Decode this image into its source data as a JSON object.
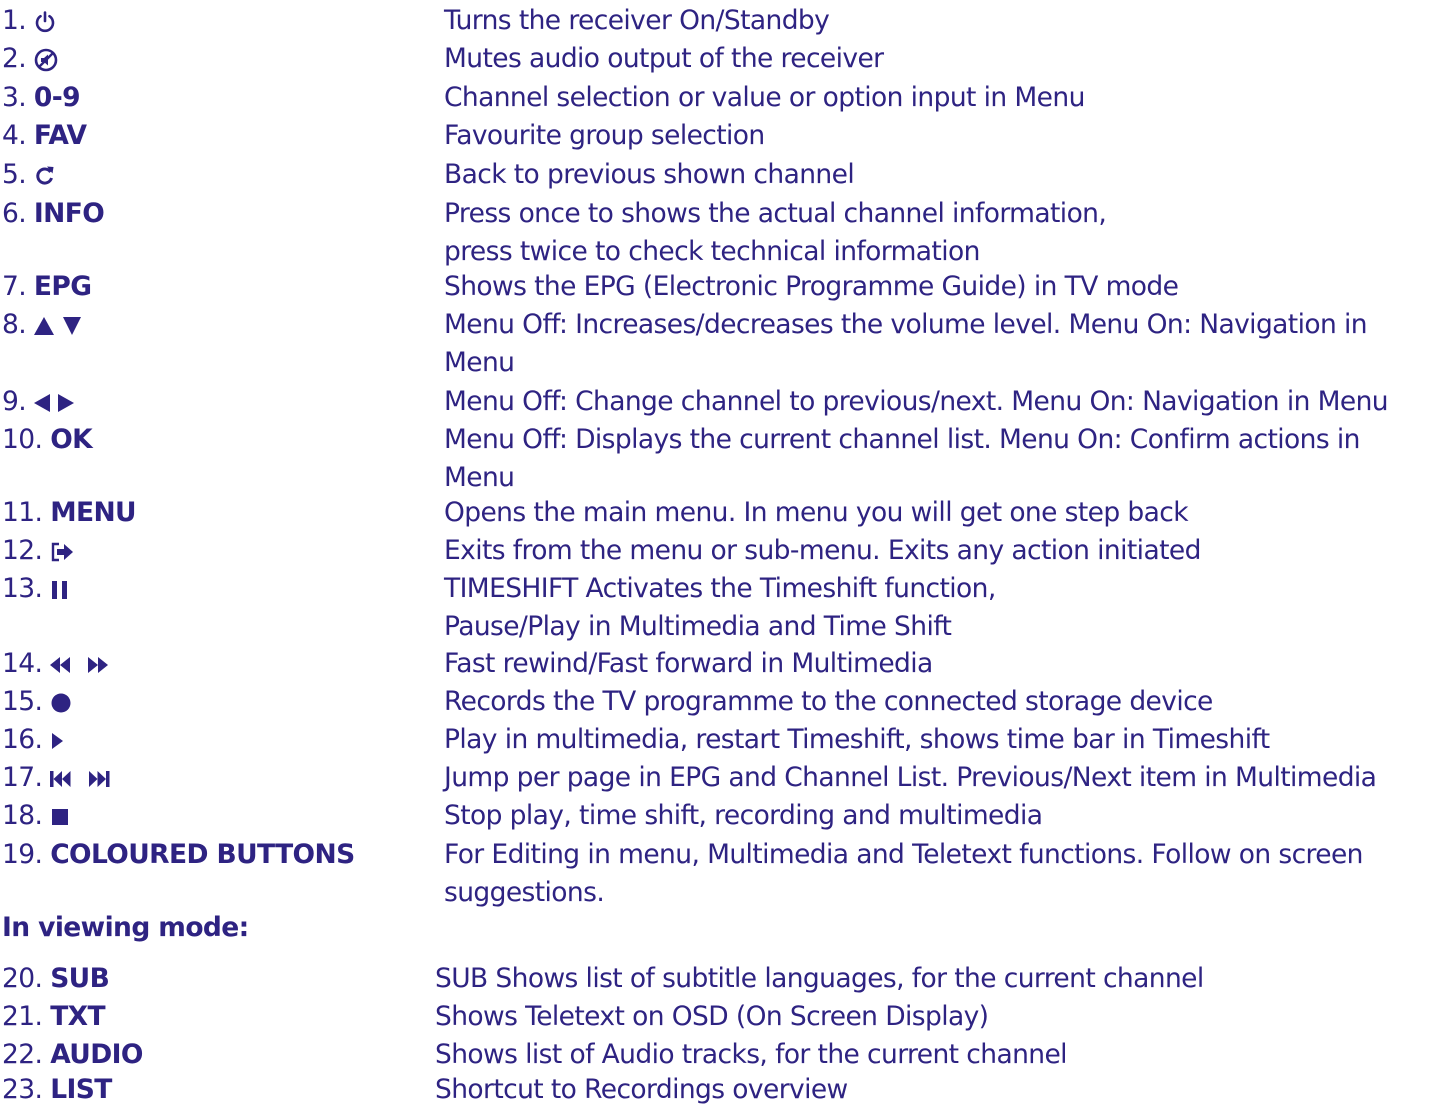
{
  "colors": {
    "text": "#2e2382",
    "background": "#ffffff"
  },
  "items": [
    {
      "num": "1.",
      "icon": "power-icon",
      "label": "",
      "desc": [
        "Turns the receiver On/Standby"
      ]
    },
    {
      "num": "2.",
      "icon": "mute-icon",
      "label": "",
      "desc": [
        "Mutes audio output of the receiver"
      ]
    },
    {
      "num": "3.",
      "icon": "",
      "label": "0-9",
      "desc": [
        "Channel selection or value or option input in Menu"
      ]
    },
    {
      "num": "4.",
      "icon": "",
      "label": "FAV",
      "desc": [
        "Favourite group selection"
      ]
    },
    {
      "num": "5.",
      "icon": "recall-icon",
      "label": "",
      "desc": [
        "Back to previous shown channel"
      ]
    },
    {
      "num": "6.",
      "icon": "",
      "label": "INFO",
      "desc": [
        "Press once to shows the actual channel information,",
        "press twice to check technical information"
      ]
    },
    {
      "num": "7.",
      "icon": "",
      "label": "EPG",
      "desc": [
        "Shows the EPG (Electronic Programme Guide) in TV mode"
      ]
    },
    {
      "num": "8.",
      "icon": "up-down-arrows-icon",
      "label": "",
      "desc": [
        "Menu Off: Increases/decreases the volume level. Menu On: Navigation in",
        "Menu"
      ]
    },
    {
      "num": "9.",
      "icon": "left-right-arrows-icon",
      "label": "",
      "desc": [
        "Menu Off: Change channel to previous/next. Menu On: Navigation in Menu"
      ]
    },
    {
      "num": "10.",
      "icon": "",
      "label": "OK",
      "desc": [
        "Menu Off: Displays the current channel list. Menu On: Confirm actions in",
        "Menu"
      ]
    },
    {
      "num": "11.",
      "icon": "",
      "label": "MENU",
      "desc": [
        "Opens the main menu. In menu you will get one step back"
      ]
    },
    {
      "num": "12.",
      "icon": "exit-icon",
      "label": "",
      "desc": [
        "Exits from the menu or sub-menu. Exits any action initiated"
      ]
    },
    {
      "num": "13.",
      "icon": "pause-icon",
      "label": "",
      "desc": [
        "TIMESHIFT Activates the Timeshift function,",
        "Pause/Play in Multimedia and Time Shift"
      ]
    },
    {
      "num": "14.",
      "icon": "rewind-forward-icon",
      "label": "",
      "desc": [
        "Fast rewind/Fast forward in Multimedia"
      ]
    },
    {
      "num": "15.",
      "icon": "record-icon",
      "label": "",
      "desc": [
        "Records the TV programme to the connected storage device"
      ]
    },
    {
      "num": "16.",
      "icon": "play-icon",
      "label": "",
      "desc": [
        "Play in multimedia, restart Timeshift, shows time bar in Timeshift"
      ]
    },
    {
      "num": "17.",
      "icon": "skip-prev-next-icon",
      "label": "",
      "desc": [
        "Jump per page in EPG and Channel List. Previous/Next item in Multimedia"
      ]
    },
    {
      "num": "18.",
      "icon": "stop-icon",
      "label": "",
      "desc": [
        "Stop play, time shift, recording and multimedia"
      ]
    },
    {
      "num": "19.",
      "icon": "",
      "label": "COLOURED BUTTONS",
      "desc": [
        "For Editing in menu, Multimedia and Teletext functions. Follow on screen",
        "suggestions."
      ]
    }
  ],
  "viewing_heading": "In viewing mode:",
  "viewing_items": [
    {
      "num": "20.",
      "label": "SUB",
      "desc": [
        "SUB Shows list of subtitle languages, for the current channel"
      ]
    },
    {
      "num": "21.",
      "label": "TXT",
      "desc": [
        "Shows Teletext on OSD (On Screen Display)"
      ]
    },
    {
      "num": "22.",
      "label": "AUDIO",
      "desc": [
        "Shows list of Audio tracks, for the current channel"
      ]
    },
    {
      "num": "23.",
      "label": "LIST",
      "desc": [
        "Shortcut to Recordings overview"
      ]
    }
  ]
}
